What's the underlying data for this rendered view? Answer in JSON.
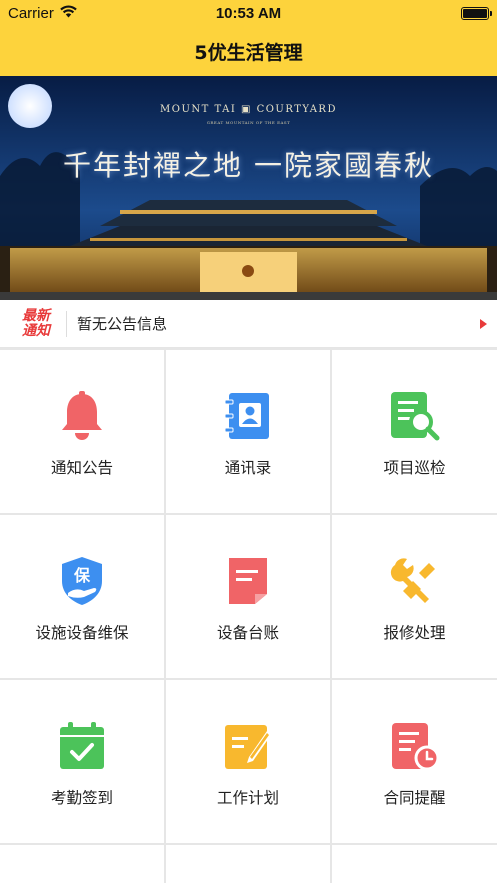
{
  "status": {
    "carrier": "Carrier",
    "time": "10:53 AM"
  },
  "nav": {
    "title": "5优生活管理"
  },
  "banner": {
    "en_title": "MOUNT TAI ▣ COURTYARD",
    "en_sub": "GREAT MOUNTAIN OF THE EAST",
    "cn_title": "千年封禪之地 一院家國春秋"
  },
  "notice": {
    "badge_line1": "最新",
    "badge_line2": "通知",
    "text": "暂无公告信息"
  },
  "menu": [
    {
      "label": "通知公告",
      "icon": "bell-icon",
      "color": "#f06467"
    },
    {
      "label": "通讯录",
      "icon": "contacts-book-icon",
      "color": "#3d8ff0"
    },
    {
      "label": "项目巡检",
      "icon": "inspection-search-icon",
      "color": "#4cc35a"
    },
    {
      "label": "设施设备维保",
      "icon": "shield-hand-icon",
      "color": "#3d8ff0"
    },
    {
      "label": "设备台账",
      "icon": "ledger-document-icon",
      "color": "#f06467"
    },
    {
      "label": "报修处理",
      "icon": "wrench-icon",
      "color": "#f8b82e"
    },
    {
      "label": "考勤签到",
      "icon": "calendar-check-icon",
      "color": "#4cc35a"
    },
    {
      "label": "工作计划",
      "icon": "plan-edit-icon",
      "color": "#f8b82e"
    },
    {
      "label": "合同提醒",
      "icon": "contract-clock-icon",
      "color": "#f06467"
    }
  ],
  "shield_char": "保"
}
